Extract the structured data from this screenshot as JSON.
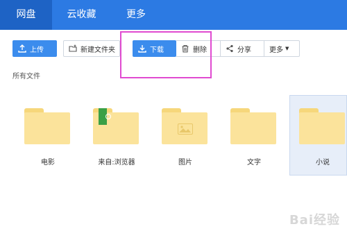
{
  "nav": {
    "tabs": [
      {
        "label": "网盘",
        "active": true
      },
      {
        "label": "云收藏",
        "active": false
      },
      {
        "label": "更多",
        "active": false
      }
    ]
  },
  "toolbar": {
    "upload_label": "上传",
    "new_folder_label": "新建文件夹",
    "download_label": "下载",
    "delete_label": "删除",
    "share_label": "分享",
    "more_label": "更多"
  },
  "breadcrumb": "所有文件",
  "files": [
    {
      "name": "电影",
      "icon": "folder-icon"
    },
    {
      "name": "来自:浏览器",
      "icon": "browser-folder-icon"
    },
    {
      "name": "图片",
      "icon": "image-folder-icon"
    },
    {
      "name": "文字",
      "icon": "folder-icon"
    },
    {
      "name": "小说",
      "icon": "folder-icon",
      "selected": true
    }
  ],
  "watermark": "Bai经验",
  "colors": {
    "nav_bg": "#2c7ae3",
    "primary_button": "#3b8ced",
    "folder": "#fbe39b",
    "highlight": "#e04ad0"
  }
}
